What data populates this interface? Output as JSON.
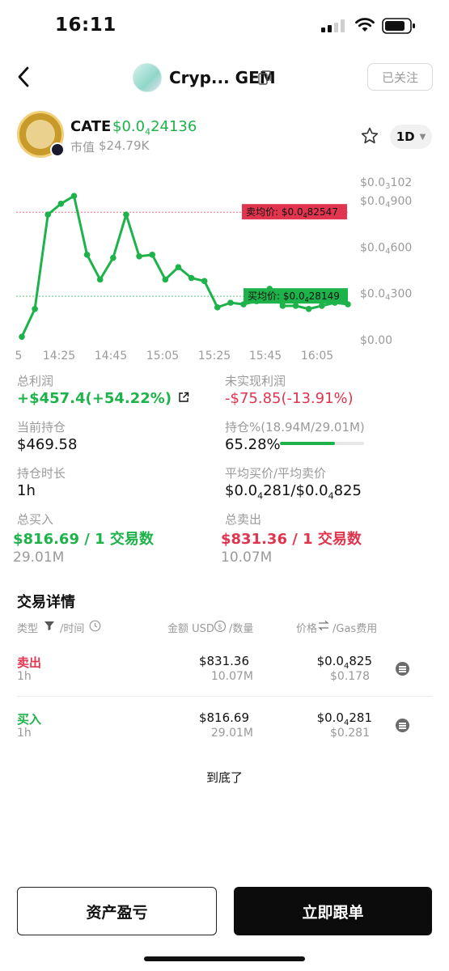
{
  "status_bar": {
    "time": "16:11"
  },
  "header": {
    "title": "Cryp... GEM",
    "follow_label": "已关注"
  },
  "token": {
    "symbol": "CATE",
    "price_prefix": "$0.0",
    "price_sub": "4",
    "price_rest": "24136",
    "mcap_label": "市值",
    "mcap_value": "$24.79K",
    "timeframe": "1D"
  },
  "chart_data": {
    "type": "line",
    "x_ticks": [
      "5",
      "14:25",
      "14:45",
      "15:05",
      "15:25",
      "15:45",
      "16:05"
    ],
    "y_ticks": [
      {
        "pre": "$0.0",
        "sub": "3",
        "post": "102"
      },
      {
        "pre": "$0.0",
        "sub": "4",
        "post": "900"
      },
      {
        "pre": "$0.0",
        "sub": "4",
        "post": "600"
      },
      {
        "pre": "$0.0",
        "sub": "4",
        "post": "300"
      },
      {
        "pre": "$0.00",
        "sub": "",
        "post": ""
      }
    ],
    "y_tick_values": [
      1020,
      900,
      600,
      300,
      0
    ],
    "ylim": [
      0,
      1020
    ],
    "unit_note": "values in units of $0.0000001",
    "series": [
      {
        "values": [
          20,
          200,
          810,
          880,
          930,
          550,
          390,
          530,
          810,
          540,
          550,
          390,
          470,
          400,
          380,
          210,
          240,
          230,
          250,
          330,
          220,
          220,
          200,
          220,
          240,
          230
        ]
      }
    ],
    "sell_avg": {
      "label_pre": "卖均价: $0.0",
      "label_sub": "4",
      "label_post": "82547",
      "value": 825.47
    },
    "buy_avg": {
      "label_pre": "买均价: $0.0",
      "label_sub": "4",
      "label_post": "28149",
      "value": 281.49
    },
    "colors": {
      "line": "#1db34a",
      "sell": "#e0344f",
      "buy": "#1db34a"
    }
  },
  "stats": {
    "total_profit_label": "总利润",
    "total_profit_value": "+$457.4(+54.22%)",
    "unrealized_label": "未实现利润",
    "unrealized_value": "-$75.85(-13.91%)",
    "holding_label": "当前持仓",
    "holding_value": "$469.58",
    "holding_pct_label": "持仓%(18.94M/29.01M)",
    "holding_pct_value": "65.28%",
    "holding_pct_fraction": 0.6528,
    "duration_label": "持仓时长",
    "duration_value": "1h",
    "avg_price_label": "平均买价/平均卖价",
    "avg_price_pre1": "$0.0",
    "avg_price_sub1": "4",
    "avg_price_post1": "281/$0.0",
    "avg_price_sub2": "4",
    "avg_price_post2": "825",
    "total_buy_label": "总买入",
    "total_buy_value": "$816.69 / 1 交易数",
    "total_buy_qty": "29.01M",
    "total_sell_label": "总卖出",
    "total_sell_value": "$831.36 / 1 交易数",
    "total_sell_qty": "10.07M"
  },
  "trades": {
    "title": "交易详情",
    "col_type": "类型",
    "col_time": "/时间",
    "col_amount": "金额 USD",
    "col_qty": "/数量",
    "col_price": "价格",
    "col_gas": "/Gas费用",
    "rows": [
      {
        "type": "卖出",
        "age": "1h",
        "amount": "$831.36",
        "qty": "10.07M",
        "price_pre": "$0.0",
        "price_sub": "4",
        "price_post": "825",
        "gas": "$0.178"
      },
      {
        "type": "买入",
        "age": "1h",
        "amount": "$816.69",
        "qty": "29.01M",
        "price_pre": "$0.0",
        "price_sub": "4",
        "price_post": "281",
        "gas": "$0.281"
      }
    ],
    "end_text": "到底了"
  },
  "buttons": {
    "pnl": "资产盈亏",
    "follow_trade": "立即跟单"
  }
}
